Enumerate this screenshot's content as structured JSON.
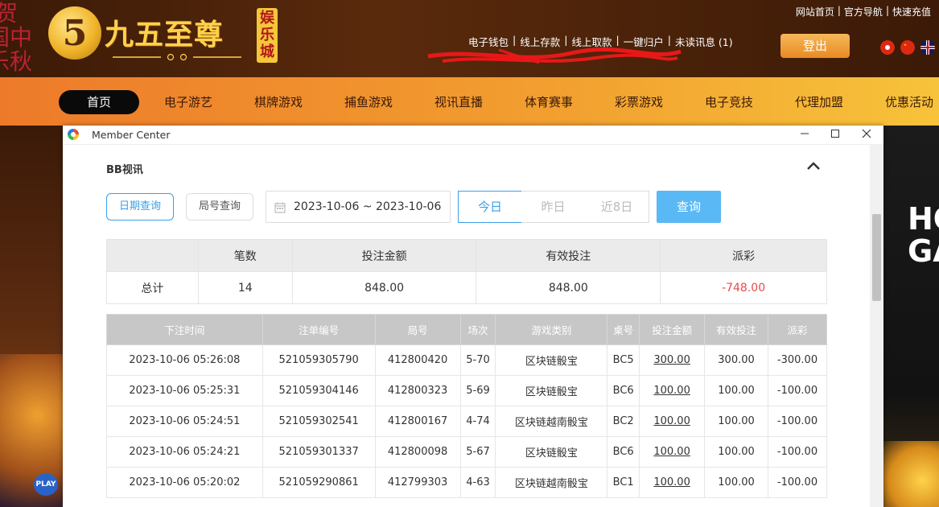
{
  "header": {
    "corner_chars": [
      "贺",
      "国中",
      "乐秋"
    ],
    "logo_mark": "5",
    "logo_text": "九五至尊",
    "logo_badge": "娱乐城",
    "top_links": [
      "网站首页",
      "官方导航",
      "快速充值"
    ],
    "mid_links": [
      "电子钱包",
      "线上存款",
      "线上取款",
      "一键归户",
      "未读讯息 (1)"
    ],
    "logout_label": "登出",
    "flags": [
      "hk-flag-icon",
      "cn-flag-icon",
      "uk-flag-icon"
    ]
  },
  "nav": {
    "items": [
      "首页",
      "电子游艺",
      "棋牌游戏",
      "捕鱼游戏",
      "视讯直播",
      "体育赛事",
      "彩票游戏",
      "电子竞技",
      "代理加盟",
      "优惠活动"
    ],
    "active_index": 0
  },
  "background": {
    "right_text": "HO GA",
    "left_badge": "PLAY"
  },
  "window": {
    "title": "Member Center",
    "controls": [
      "minimize-icon",
      "maximize-icon",
      "close-icon"
    ]
  },
  "panel": {
    "section_title": "BB视讯",
    "filter_buttons": {
      "date_query": "日期查询",
      "round_query": "局号查询"
    },
    "date_range": "2023-10-06 ~ 2023-10-06",
    "quick_ranges": [
      "今日",
      "昨日",
      "近8日"
    ],
    "quick_active_index": 0,
    "search_label": "查询"
  },
  "summary": {
    "headers": [
      "",
      "笔数",
      "投注金额",
      "有效投注",
      "派彩"
    ],
    "row": [
      "总计",
      "14",
      "848.00",
      "848.00",
      "-748.00"
    ]
  },
  "detail": {
    "headers": [
      "下注时间",
      "注单编号",
      "局号",
      "场次",
      "游戏类别",
      "桌号",
      "投注金额",
      "有效投注",
      "派彩"
    ],
    "rows": [
      [
        "2023-10-06 05:26:08",
        "521059305790",
        "412800420",
        "5-70",
        "区块链骰宝",
        "BC5",
        "300.00",
        "300.00",
        "-300.00"
      ],
      [
        "2023-10-06 05:25:31",
        "521059304146",
        "412800323",
        "5-69",
        "区块链骰宝",
        "BC6",
        "100.00",
        "100.00",
        "-100.00"
      ],
      [
        "2023-10-06 05:24:51",
        "521059302541",
        "412800167",
        "4-74",
        "区块链越南骰宝",
        "BC2",
        "100.00",
        "100.00",
        "-100.00"
      ],
      [
        "2023-10-06 05:24:21",
        "521059301337",
        "412800098",
        "5-67",
        "区块链骰宝",
        "BC6",
        "100.00",
        "100.00",
        "-100.00"
      ],
      [
        "2023-10-06 05:20:02",
        "521059290861",
        "412799303",
        "4-63",
        "区块链越南骰宝",
        "BC1",
        "100.00",
        "100.00",
        "-100.00"
      ]
    ]
  }
}
